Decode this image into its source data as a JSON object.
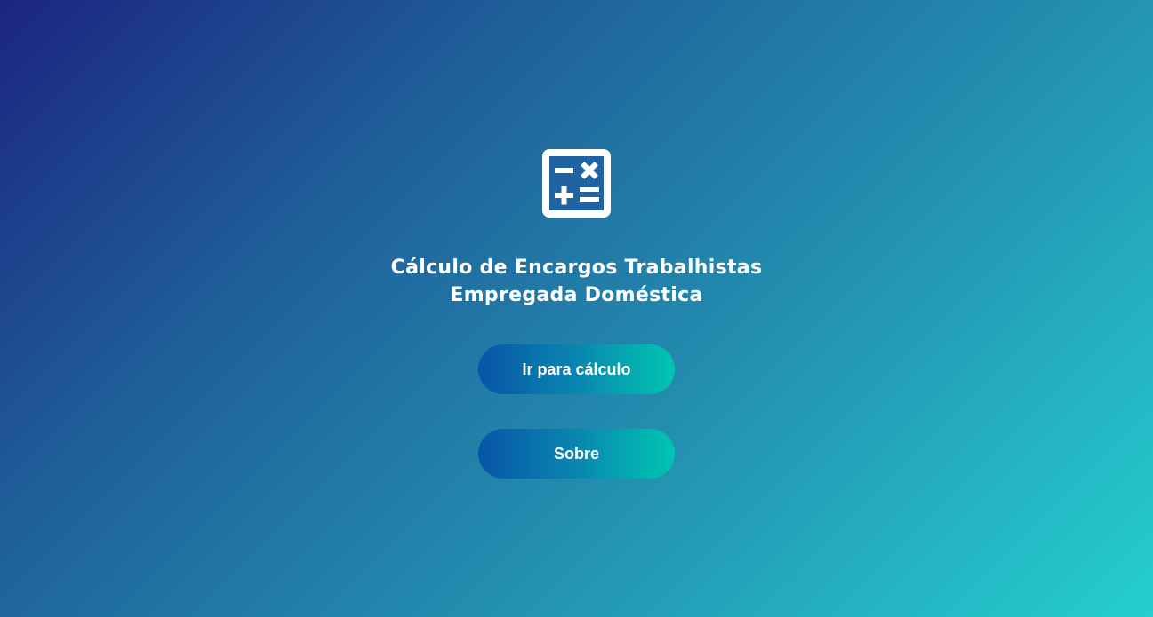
{
  "colors": {
    "background_start": "#1c2580",
    "background_end": "#25cfcf",
    "button_start": "#0756a6",
    "button_end": "#00c6b0",
    "text": "#ffffff"
  },
  "icon": "calculator-icon",
  "title": {
    "line1": "Cálculo de Encargos Trabalhistas",
    "line2": "Empregada Doméstica"
  },
  "buttons": {
    "calculate_label": "Ir para cálculo",
    "about_label": "Sobre"
  }
}
